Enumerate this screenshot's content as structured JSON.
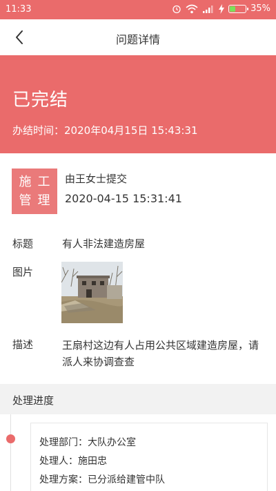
{
  "status_bar": {
    "time": "11:33",
    "battery_text": "35%",
    "battery_level": 0.35,
    "icons": [
      "alarm-icon",
      "wifi-icon",
      "signal-icon",
      "charging-icon",
      "battery-icon"
    ]
  },
  "nav": {
    "title": "问题详情",
    "back_icon": "chevron-left-icon"
  },
  "banner": {
    "status": "已完结",
    "time_label": "办结时间：",
    "time_value": "2020年04月15日 15:43:31"
  },
  "submission": {
    "category_chars": [
      "施",
      "工",
      "管",
      "理"
    ],
    "submitter": "由王女士提交",
    "submitted_at": "2020-04-15 15:31:41"
  },
  "fields": {
    "title_label": "标题",
    "title_value": "有人非法建造房屋",
    "image_label": "图片",
    "description_label": "描述",
    "description_value": "王扇村这边有人占用公共区域建造房屋，请派人来协调查查"
  },
  "progress": {
    "section_title": "处理进度",
    "items": [
      {
        "department_label": "处理部门：",
        "department": "大队办公室",
        "handler_label": "处理人：",
        "handler": "施田忠",
        "plan_label": "处理方案：",
        "plan": "已分派给建管中队"
      }
    ]
  },
  "colors": {
    "accent": "#ea6b6b",
    "badge": "#ea7a7a",
    "section_bg": "#f2f2f2"
  }
}
